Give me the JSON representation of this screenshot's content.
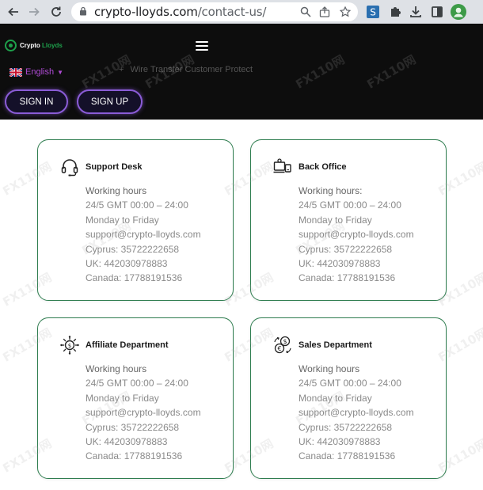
{
  "browser": {
    "url_domain": "crypto-lloyds.com",
    "url_path": "/contact-us/"
  },
  "header": {
    "logo_prefix": "Crypto ",
    "logo_suffix": "Lloyds",
    "language": "English",
    "faded_text": "Wire Transfer Customer Protect",
    "sign_in_label": "SIGN IN",
    "sign_up_label": "SIGN UP"
  },
  "cards": [
    {
      "icon": "headset-icon",
      "title": "Support Desk",
      "lines": [
        "Working hours",
        "24/5 GMT 00:00 – 24:00",
        "Monday to Friday",
        "support@crypto-lloyds.com",
        "Cyprus: 35722222658",
        "UK: 442030978883",
        "Canada: 17788191536"
      ]
    },
    {
      "icon": "back-office-icon",
      "title": "Back Office",
      "lines": [
        "Working hours:",
        "24/5 GMT 00:00 – 24:00",
        "Monday to Friday",
        "support@crypto-lloyds.com",
        "Cyprus: 35722222658",
        "UK: 442030978883",
        "Canada: 17788191536"
      ]
    },
    {
      "icon": "affiliate-icon",
      "title": "Affiliate Department",
      "lines": [
        "Working hours",
        "24/5 GMT 00:00 – 24:00",
        "Monday to Friday",
        "support@crypto-lloyds.com",
        "Cyprus: 35722222658",
        "UK: 442030978883",
        "Canada: 17788191536"
      ]
    },
    {
      "icon": "currency-exchange-icon",
      "title": "Sales Department",
      "lines": [
        "Working hours",
        "24/5 GMT 00:00 – 24:00",
        "Monday to Friday",
        "support@crypto-lloyds.com",
        "Cyprus: 35722222658",
        "UK: 442030978883",
        "Canada: 17788191536"
      ]
    }
  ],
  "watermark": "FX110网"
}
